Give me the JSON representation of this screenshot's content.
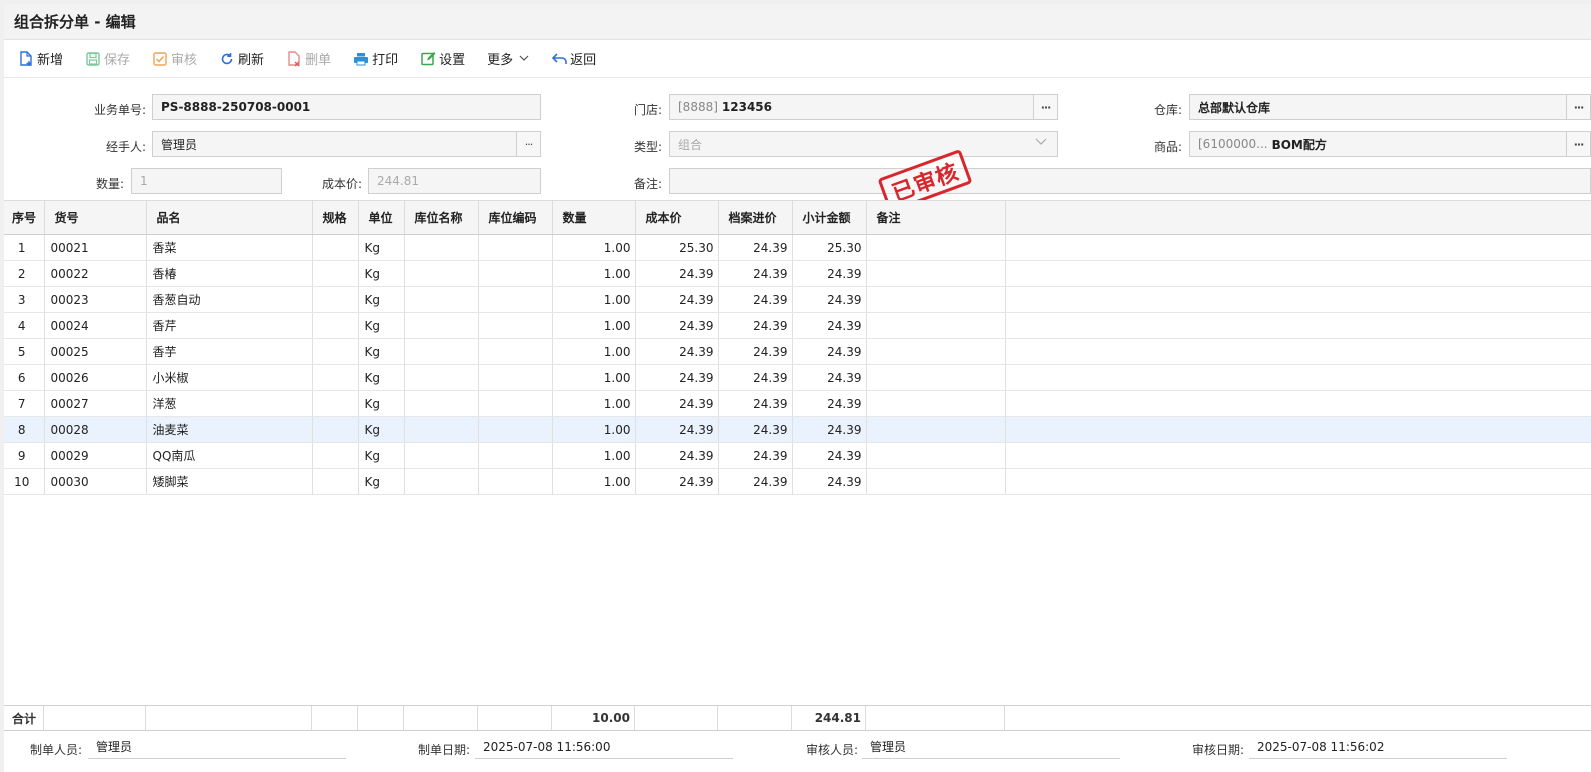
{
  "title": "组合拆分单 - 编辑",
  "toolbar": {
    "new_label": "新增",
    "save_label": "保存",
    "audit_label": "审核",
    "refresh_label": "刷新",
    "delete_label": "删单",
    "print_label": "打印",
    "settings_label": "设置",
    "more_label": "更多",
    "back_label": "返回"
  },
  "form": {
    "doc_no_label": "业务单号:",
    "doc_no": "PS-8888-250708-0001",
    "store_label": "门店:",
    "store_code": "[8888]",
    "store_name": "123456",
    "warehouse_label": "仓库:",
    "warehouse": "总部默认仓库",
    "handler_label": "经手人:",
    "handler": "管理员",
    "type_label": "类型:",
    "type": "组合",
    "product_label": "商品:",
    "product_code": "[6100000...",
    "product_name": "BOM配方",
    "qty_label": "数量:",
    "qty": "1",
    "cost_label": "成本价:",
    "cost": "244.81",
    "remark_label": "备注:",
    "remark": ""
  },
  "stamp": "已审核",
  "table": {
    "headers": [
      "序号",
      "货号",
      "品名",
      "规格",
      "单位",
      "库位名称",
      "库位编码",
      "数量",
      "成本价",
      "档案进价",
      "小计金额",
      "备注"
    ],
    "rows": [
      [
        "1",
        "00021",
        "香菜",
        "",
        "Kg",
        "",
        "",
        "1.00",
        "25.30",
        "24.39",
        "25.30",
        ""
      ],
      [
        "2",
        "00022",
        "香椿",
        "",
        "Kg",
        "",
        "",
        "1.00",
        "24.39",
        "24.39",
        "24.39",
        ""
      ],
      [
        "3",
        "00023",
        "香葱自动",
        "",
        "Kg",
        "",
        "",
        "1.00",
        "24.39",
        "24.39",
        "24.39",
        ""
      ],
      [
        "4",
        "00024",
        "香芹",
        "",
        "Kg",
        "",
        "",
        "1.00",
        "24.39",
        "24.39",
        "24.39",
        ""
      ],
      [
        "5",
        "00025",
        "香芋",
        "",
        "Kg",
        "",
        "",
        "1.00",
        "24.39",
        "24.39",
        "24.39",
        ""
      ],
      [
        "6",
        "00026",
        "小米椒",
        "",
        "Kg",
        "",
        "",
        "1.00",
        "24.39",
        "24.39",
        "24.39",
        ""
      ],
      [
        "7",
        "00027",
        "洋葱",
        "",
        "Kg",
        "",
        "",
        "1.00",
        "24.39",
        "24.39",
        "24.39",
        ""
      ],
      [
        "8",
        "00028",
        "油麦菜",
        "",
        "Kg",
        "",
        "",
        "1.00",
        "24.39",
        "24.39",
        "24.39",
        ""
      ],
      [
        "9",
        "00029",
        "QQ南瓜",
        "",
        "Kg",
        "",
        "",
        "1.00",
        "24.39",
        "24.39",
        "24.39",
        ""
      ],
      [
        "10",
        "00030",
        "矮脚菜",
        "",
        "Kg",
        "",
        "",
        "1.00",
        "24.39",
        "24.39",
        "24.39",
        ""
      ]
    ],
    "selected_row": 7,
    "summary": {
      "label": "合计",
      "qty_total": "10.00",
      "amount_total": "244.81"
    }
  },
  "footer": {
    "creator_label": "制单人员:",
    "creator": "管理员",
    "created_label": "制单日期:",
    "created": "2025-07-08 11:56:00",
    "auditor_label": "审核人员:",
    "auditor": "管理员",
    "audited_label": "审核日期:",
    "audited": "2025-07-08 11:56:02"
  },
  "colors": {
    "stamp": "#d9262c",
    "selected_row": "#e9f2fd",
    "save_icon": "#3fb36b",
    "audit_icon": "#f0a35a",
    "refresh_icon": "#2f6fd6",
    "delete_icon": "#e05a5a",
    "print_icon": "#2f8fd6",
    "settings_icon": "#3aa64a"
  }
}
